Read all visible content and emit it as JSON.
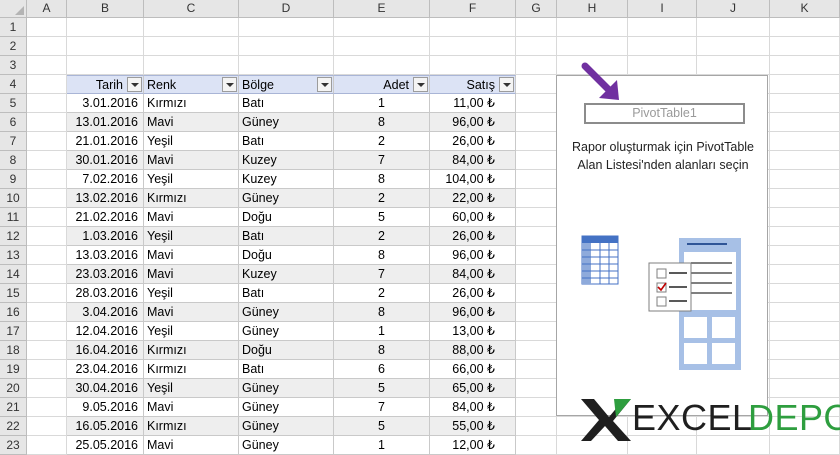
{
  "columns": [
    "A",
    "B",
    "C",
    "D",
    "E",
    "F",
    "G",
    "H",
    "I",
    "J",
    "K"
  ],
  "rows": [
    "1",
    "2",
    "3",
    "4",
    "5",
    "6",
    "7",
    "8",
    "9",
    "10",
    "11",
    "12",
    "13",
    "14",
    "15",
    "16",
    "17",
    "18",
    "19",
    "20",
    "21",
    "22",
    "23"
  ],
  "table": {
    "headers": [
      "Tarih",
      "Renk",
      "Bölge",
      "Adet",
      "Satış"
    ],
    "rows": [
      [
        "3.01.2016",
        "Kırmızı",
        "Batı",
        "1",
        "11,00 ₺"
      ],
      [
        "13.01.2016",
        "Mavi",
        "Güney",
        "8",
        "96,00 ₺"
      ],
      [
        "21.01.2016",
        "Yeşil",
        "Batı",
        "2",
        "26,00 ₺"
      ],
      [
        "30.01.2016",
        "Mavi",
        "Kuzey",
        "7",
        "84,00 ₺"
      ],
      [
        "7.02.2016",
        "Yeşil",
        "Kuzey",
        "8",
        "104,00 ₺"
      ],
      [
        "13.02.2016",
        "Kırmızı",
        "Güney",
        "2",
        "22,00 ₺"
      ],
      [
        "21.02.2016",
        "Mavi",
        "Doğu",
        "5",
        "60,00 ₺"
      ],
      [
        "1.03.2016",
        "Yeşil",
        "Batı",
        "2",
        "26,00 ₺"
      ],
      [
        "13.03.2016",
        "Mavi",
        "Doğu",
        "8",
        "96,00 ₺"
      ],
      [
        "23.03.2016",
        "Mavi",
        "Kuzey",
        "7",
        "84,00 ₺"
      ],
      [
        "28.03.2016",
        "Yeşil",
        "Batı",
        "2",
        "26,00 ₺"
      ],
      [
        "3.04.2016",
        "Mavi",
        "Güney",
        "8",
        "96,00 ₺"
      ],
      [
        "12.04.2016",
        "Yeşil",
        "Güney",
        "1",
        "13,00 ₺"
      ],
      [
        "16.04.2016",
        "Kırmızı",
        "Doğu",
        "8",
        "88,00 ₺"
      ],
      [
        "23.04.2016",
        "Kırmızı",
        "Batı",
        "6",
        "66,00 ₺"
      ],
      [
        "30.04.2016",
        "Yeşil",
        "Güney",
        "5",
        "65,00 ₺"
      ],
      [
        "9.05.2016",
        "Mavi",
        "Güney",
        "7",
        "84,00 ₺"
      ],
      [
        "16.05.2016",
        "Kırmızı",
        "Güney",
        "5",
        "55,00 ₺"
      ],
      [
        "25.05.2016",
        "Mavi",
        "Güney",
        "1",
        "12,00 ₺"
      ]
    ]
  },
  "pivot": {
    "name": "PivotTable1",
    "instruction_line1": "Rapor oluşturmak için PivotTable",
    "instruction_line2": "Alan Listesi'nden alanları seçin"
  },
  "logo": {
    "part1": "EXCEL",
    "part2": "DEPO"
  },
  "colors": {
    "arrow": "#7030a0",
    "header_fill": "#dce3f5",
    "logo_green": "#2e9e3f",
    "icon_blue": "#4472c4"
  },
  "icons": [
    "dropdown-arrow-icon",
    "pivot-field-list-illustration",
    "purple-arrow-icon",
    "excel-depo-x-icon"
  ]
}
